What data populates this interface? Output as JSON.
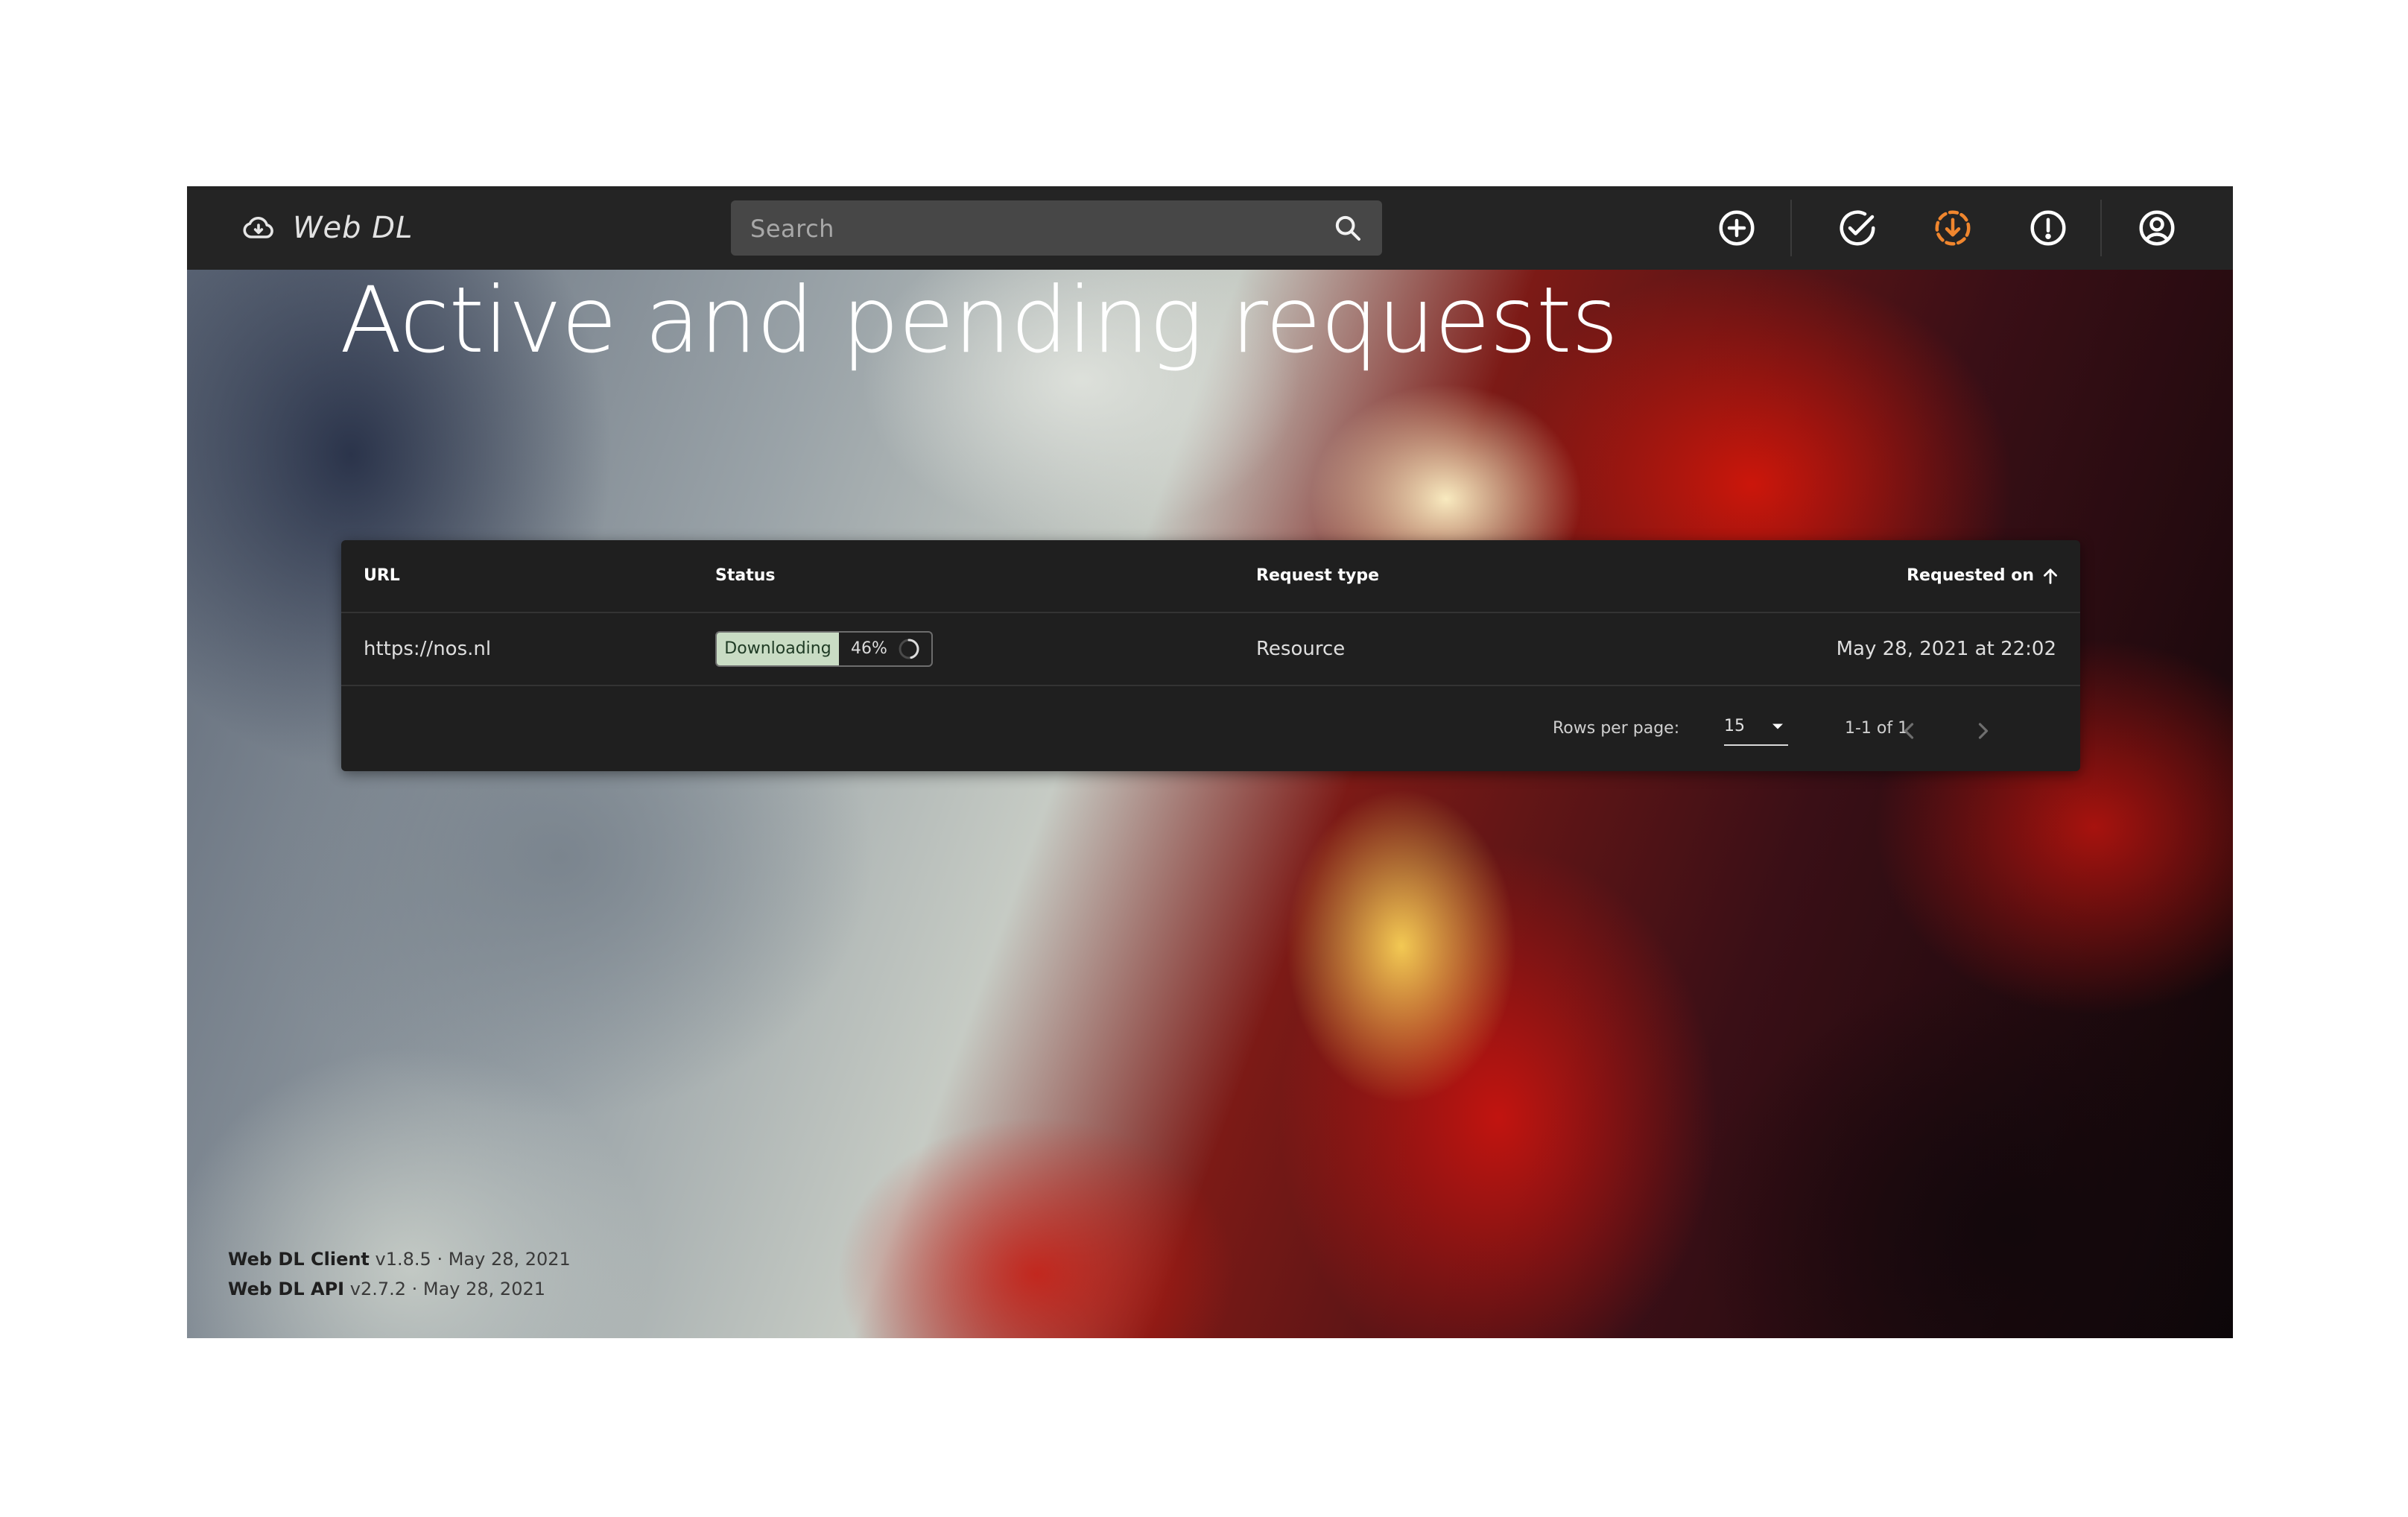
{
  "app": {
    "brand_title": "Web DL",
    "brand_icon": "cloud-download-icon"
  },
  "search": {
    "placeholder": "Search",
    "value": "",
    "icon": "search-icon"
  },
  "nav": {
    "icons": [
      {
        "name": "add-circle-icon",
        "label": "New request",
        "active": false
      },
      {
        "name": "check-circle-icon",
        "label": "Completed",
        "active": false
      },
      {
        "name": "download-progress-icon",
        "label": "Active and pending",
        "active": true
      },
      {
        "name": "alert-circle-icon",
        "label": "Failed",
        "active": false
      },
      {
        "name": "account-circle-icon",
        "label": "Account",
        "active": false
      }
    ]
  },
  "page": {
    "title": "Active and pending requests"
  },
  "table": {
    "columns": {
      "url": "URL",
      "status": "Status",
      "request_type": "Request type",
      "requested_on": "Requested on"
    },
    "sort": {
      "column": "requested_on",
      "direction": "asc",
      "icon": "arrow-up-icon"
    },
    "rows": [
      {
        "url": "https://nos.nl",
        "status_label": "Downloading",
        "progress_text": "46%",
        "progress": 0.46,
        "request_type": "Resource",
        "requested_on": "May 28, 2021 at 22:02"
      }
    ],
    "footer": {
      "rows_per_page_label": "Rows per page:",
      "rows_per_page_value": "15",
      "range": "1-1 of 1"
    }
  },
  "versions": {
    "client_name": "Web DL Client",
    "client_version": "v1.8.5 · May 28, 2021",
    "api_name": "Web DL API",
    "api_version": "v2.7.2 · May 28, 2021"
  },
  "colors": {
    "topbar": "#242424",
    "active_nav": "#f0862e",
    "status_chip": "#c9dcc4"
  }
}
